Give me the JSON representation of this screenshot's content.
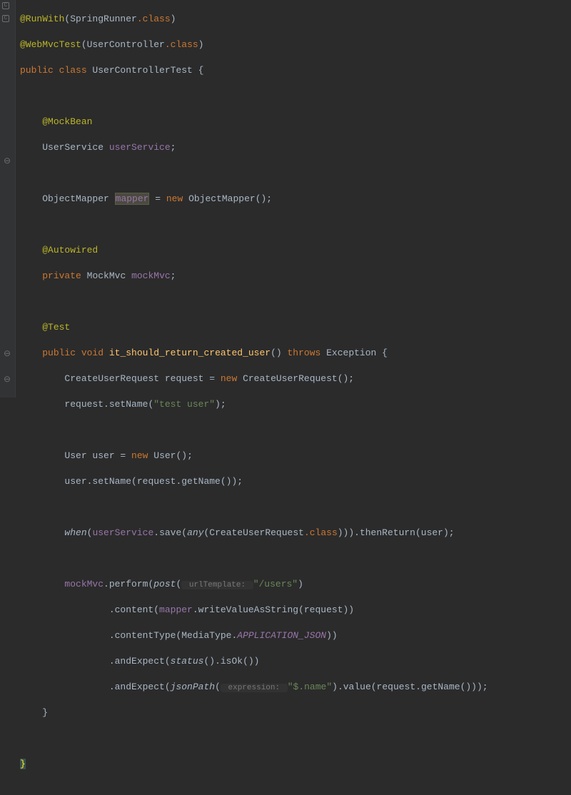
{
  "code": {
    "l1_annotation": "@RunWith",
    "l1_param": "(SpringRunner",
    "l1_class": ".class",
    "l1_close": ")",
    "l2_annotation": "@WebMvcTest",
    "l2_param": "(UserController",
    "l2_class": ".class",
    "l2_close": ")",
    "l3_pub": "public class ",
    "l3_name": "UserControllerTest ",
    "l3_brace": "{",
    "l5_ann": "@MockBean",
    "l6_type": "UserService ",
    "l6_field": "userService",
    "l6_semi": ";",
    "l8_type": "ObjectMapper ",
    "l8_field": "mapper",
    "l8_eq": " = ",
    "l8_new": "new ",
    "l8_ctor": "ObjectMapper()",
    "l8_semi": ";",
    "l10_ann": "@Autowired",
    "l11_priv": "private ",
    "l11_type": "MockMvc ",
    "l11_field": "mockMvc",
    "l11_semi": ";",
    "l13_ann": "@Test",
    "l14_pub": "public ",
    "l14_void": "void ",
    "l14_name": "it_should_return_created_user",
    "l14_paren": "() ",
    "l14_throws": "throws ",
    "l14_exc": "Exception {",
    "l15": "CreateUserRequest request = ",
    "l15_new": "new ",
    "l15_ctor": "CreateUserRequest();",
    "l16": "request.setName(",
    "l16_str": "\"test user\"",
    "l16_close": ");",
    "l18": "User user = ",
    "l18_new": "new ",
    "l18_ctor": "User();",
    "l19": "user.setName(request.getName());",
    "l21_when": "when",
    "l21_open": "(",
    "l21_svc": "userService",
    "l21_save": ".save(",
    "l21_any": "any",
    "l21_anyarg": "(CreateUserRequest",
    "l21_class": ".class",
    "l21_anyclose": "))).thenReturn(user);",
    "l23_mock": "mockMvc",
    "l23_perf": ".perform(",
    "l23_post": "post",
    "l23_open": "(",
    "l23_hint": " urlTemplate: ",
    "l23_str": "\"/users\"",
    "l23_close": ")",
    "l24_dot": ".content(",
    "l24_mapper": "mapper",
    "l24_rest": ".writeValueAsString(request))",
    "l25_dot": ".contentType(MediaType.",
    "l25_const": "APPLICATION_JSON",
    "l25_close": "))",
    "l26_dot": ".andExpect(",
    "l26_status": "status",
    "l26_rest": "().isOk())",
    "l27_dot": ".andExpect(",
    "l27_jp": "jsonPath",
    "l27_open": "(",
    "l27_hint": " expression: ",
    "l27_str": "\"$.name\"",
    "l27_close": ").value(request.getName()));",
    "l28_brace": "}",
    "l29_brace": "}"
  }
}
